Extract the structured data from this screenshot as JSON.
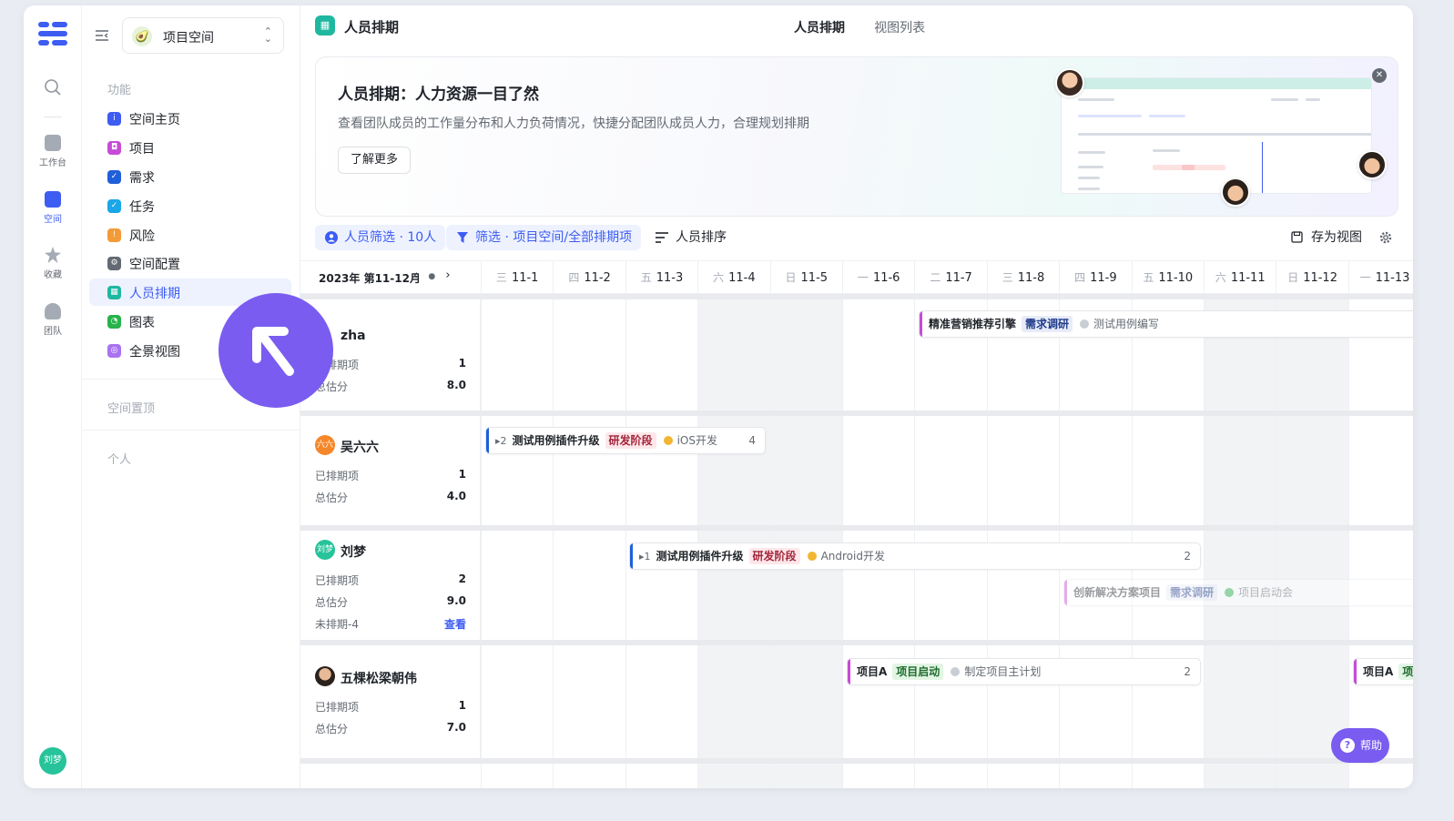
{
  "rail": {
    "items": [
      {
        "label": "工作台"
      },
      {
        "label": "空间"
      },
      {
        "label": "收藏"
      },
      {
        "label": "团队"
      }
    ],
    "user_avatar": "刘梦"
  },
  "sidebar": {
    "space_name": "项目空间",
    "section_features": "功能",
    "items": [
      {
        "label": "空间主页",
        "color": "#3d5cf2"
      },
      {
        "label": "项目",
        "color": "#c64bd6"
      },
      {
        "label": "需求",
        "color": "#1f5fd9"
      },
      {
        "label": "任务",
        "color": "#1aa6e8"
      },
      {
        "label": "风险",
        "color": "#f29b38"
      },
      {
        "label": "空间配置",
        "color": "#646a73"
      },
      {
        "label": "人员排期",
        "color": "#1fb7a0"
      },
      {
        "label": "图表",
        "color": "#27b24a"
      },
      {
        "label": "全景视图",
        "color": "#a872f0"
      }
    ],
    "section_pinned": "空间置顶",
    "section_personal": "个人"
  },
  "header": {
    "title": "人员排期",
    "tabs": [
      "人员排期",
      "视图列表"
    ]
  },
  "banner": {
    "title": "人员排期：人力资源一目了然",
    "description": "查看团队成员的工作量分布和人力负荷情况，快捷分配团队成员人力，合理规划排期",
    "button": "了解更多"
  },
  "toolbar": {
    "people_filter": "人员筛选 · 10人",
    "filter": "筛选 · 项目空间/全部排期项",
    "sort": "人员排序",
    "save_view": "存为视图"
  },
  "schedule": {
    "period": "2023年 第11-12月",
    "days": [
      {
        "wd": "三",
        "date": "11-1"
      },
      {
        "wd": "四",
        "date": "11-2"
      },
      {
        "wd": "五",
        "date": "11-3"
      },
      {
        "wd": "六",
        "date": "11-4"
      },
      {
        "wd": "日",
        "date": "11-5"
      },
      {
        "wd": "一",
        "date": "11-6"
      },
      {
        "wd": "二",
        "date": "11-7"
      },
      {
        "wd": "三",
        "date": "11-8"
      },
      {
        "wd": "四",
        "date": "11-9"
      },
      {
        "wd": "五",
        "date": "11-10"
      },
      {
        "wd": "六",
        "date": "11-11"
      },
      {
        "wd": "日",
        "date": "11-12"
      },
      {
        "wd": "一",
        "date": "11-13"
      }
    ],
    "people": [
      {
        "name": "zha",
        "scheduled_label": "已排期项",
        "scheduled": "1",
        "score_label": "总估分",
        "score": "8.0"
      },
      {
        "name": "吴六六",
        "avatar": "六六",
        "scheduled_label": "已排期项",
        "scheduled": "1",
        "score_label": "总估分",
        "score": "4.0"
      },
      {
        "name": "刘梦",
        "avatar": "刘梦",
        "scheduled_label": "已排期项",
        "scheduled": "2",
        "score_label": "总估分",
        "score": "9.0",
        "unscheduled_label": "未排期-4",
        "view_link": "查看"
      },
      {
        "name": "五棵松梁朝伟",
        "scheduled_label": "已排期项",
        "scheduled": "1",
        "score_label": "总估分",
        "score": "7.0"
      }
    ],
    "tasks": [
      {
        "name": "精准营销推荐引擎",
        "tag": "需求调研",
        "status": "测试用例编写"
      },
      {
        "count": "▸2",
        "name": "测试用例插件升级",
        "tag": "研发阶段",
        "status": "iOS开发",
        "num": "4"
      },
      {
        "count": "▸1",
        "name": "测试用例插件升级",
        "tag": "研发阶段",
        "status": "Android开发",
        "num": "2"
      },
      {
        "name": "创新解决方案项目",
        "tag": "需求调研",
        "status": "项目启动会"
      },
      {
        "name": "项目A",
        "tag": "项目启动",
        "status": "制定项目主计划",
        "num": "2"
      },
      {
        "name": "项目A",
        "tag": "项"
      }
    ]
  },
  "help": "帮助"
}
